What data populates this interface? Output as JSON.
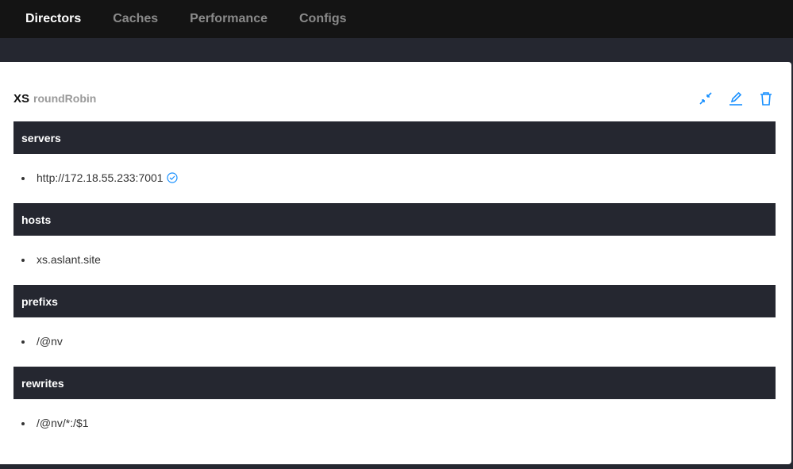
{
  "nav": {
    "tabs": [
      {
        "label": "Directors",
        "active": true
      },
      {
        "label": "Caches"
      },
      {
        "label": "Performance"
      },
      {
        "label": "Configs"
      }
    ]
  },
  "director": {
    "name": "XS",
    "policy": "roundRobin",
    "actions": [
      "collapse-icon",
      "edit-icon",
      "delete-icon"
    ],
    "sections": [
      {
        "title": "servers",
        "items": [
          "http://172.18.55.233:7001"
        ],
        "status": "healthy"
      },
      {
        "title": "hosts",
        "items": [
          "xs.aslant.site"
        ]
      },
      {
        "title": "prefixs",
        "items": [
          "/@nv"
        ]
      },
      {
        "title": "rewrites",
        "items": [
          "/@nv/*:/$1"
        ]
      }
    ]
  },
  "colors": {
    "accent": "#1890ff",
    "header": "#252730",
    "nav": "#141414"
  }
}
